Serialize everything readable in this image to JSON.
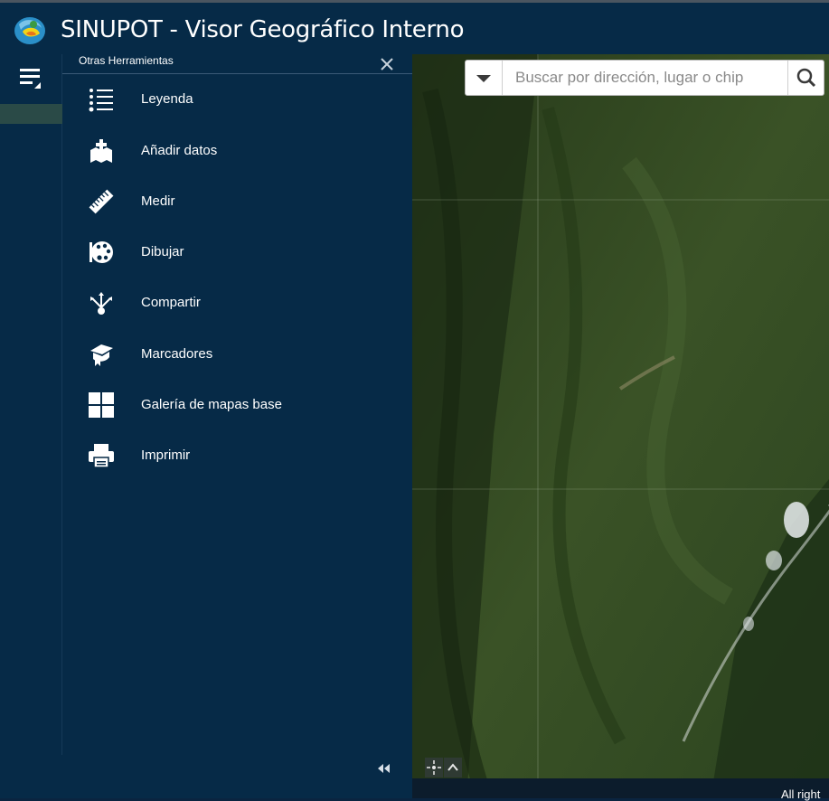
{
  "header": {
    "title": "SINUPOT - Visor Geográfico Interno"
  },
  "panel": {
    "title": "Otras Herramientas",
    "tools": [
      {
        "label": "Leyenda",
        "icon": "list-legend-icon"
      },
      {
        "label": "Añadir datos",
        "icon": "add-data-icon"
      },
      {
        "label": "Medir",
        "icon": "ruler-icon"
      },
      {
        "label": "Dibujar",
        "icon": "palette-icon"
      },
      {
        "label": "Compartir",
        "icon": "share-icon"
      },
      {
        "label": "Marcadores",
        "icon": "bookmark-icon"
      },
      {
        "label": "Galería de mapas base",
        "icon": "basemap-gallery-icon"
      },
      {
        "label": "Imprimir",
        "icon": "printer-icon"
      }
    ]
  },
  "search": {
    "placeholder": "Buscar por dirección, lugar o chip"
  },
  "map": {
    "attribution": "All right"
  },
  "colors": {
    "header_bg": "#062a47",
    "panel_bg": "#062a47",
    "accent": "#2a4a47"
  }
}
